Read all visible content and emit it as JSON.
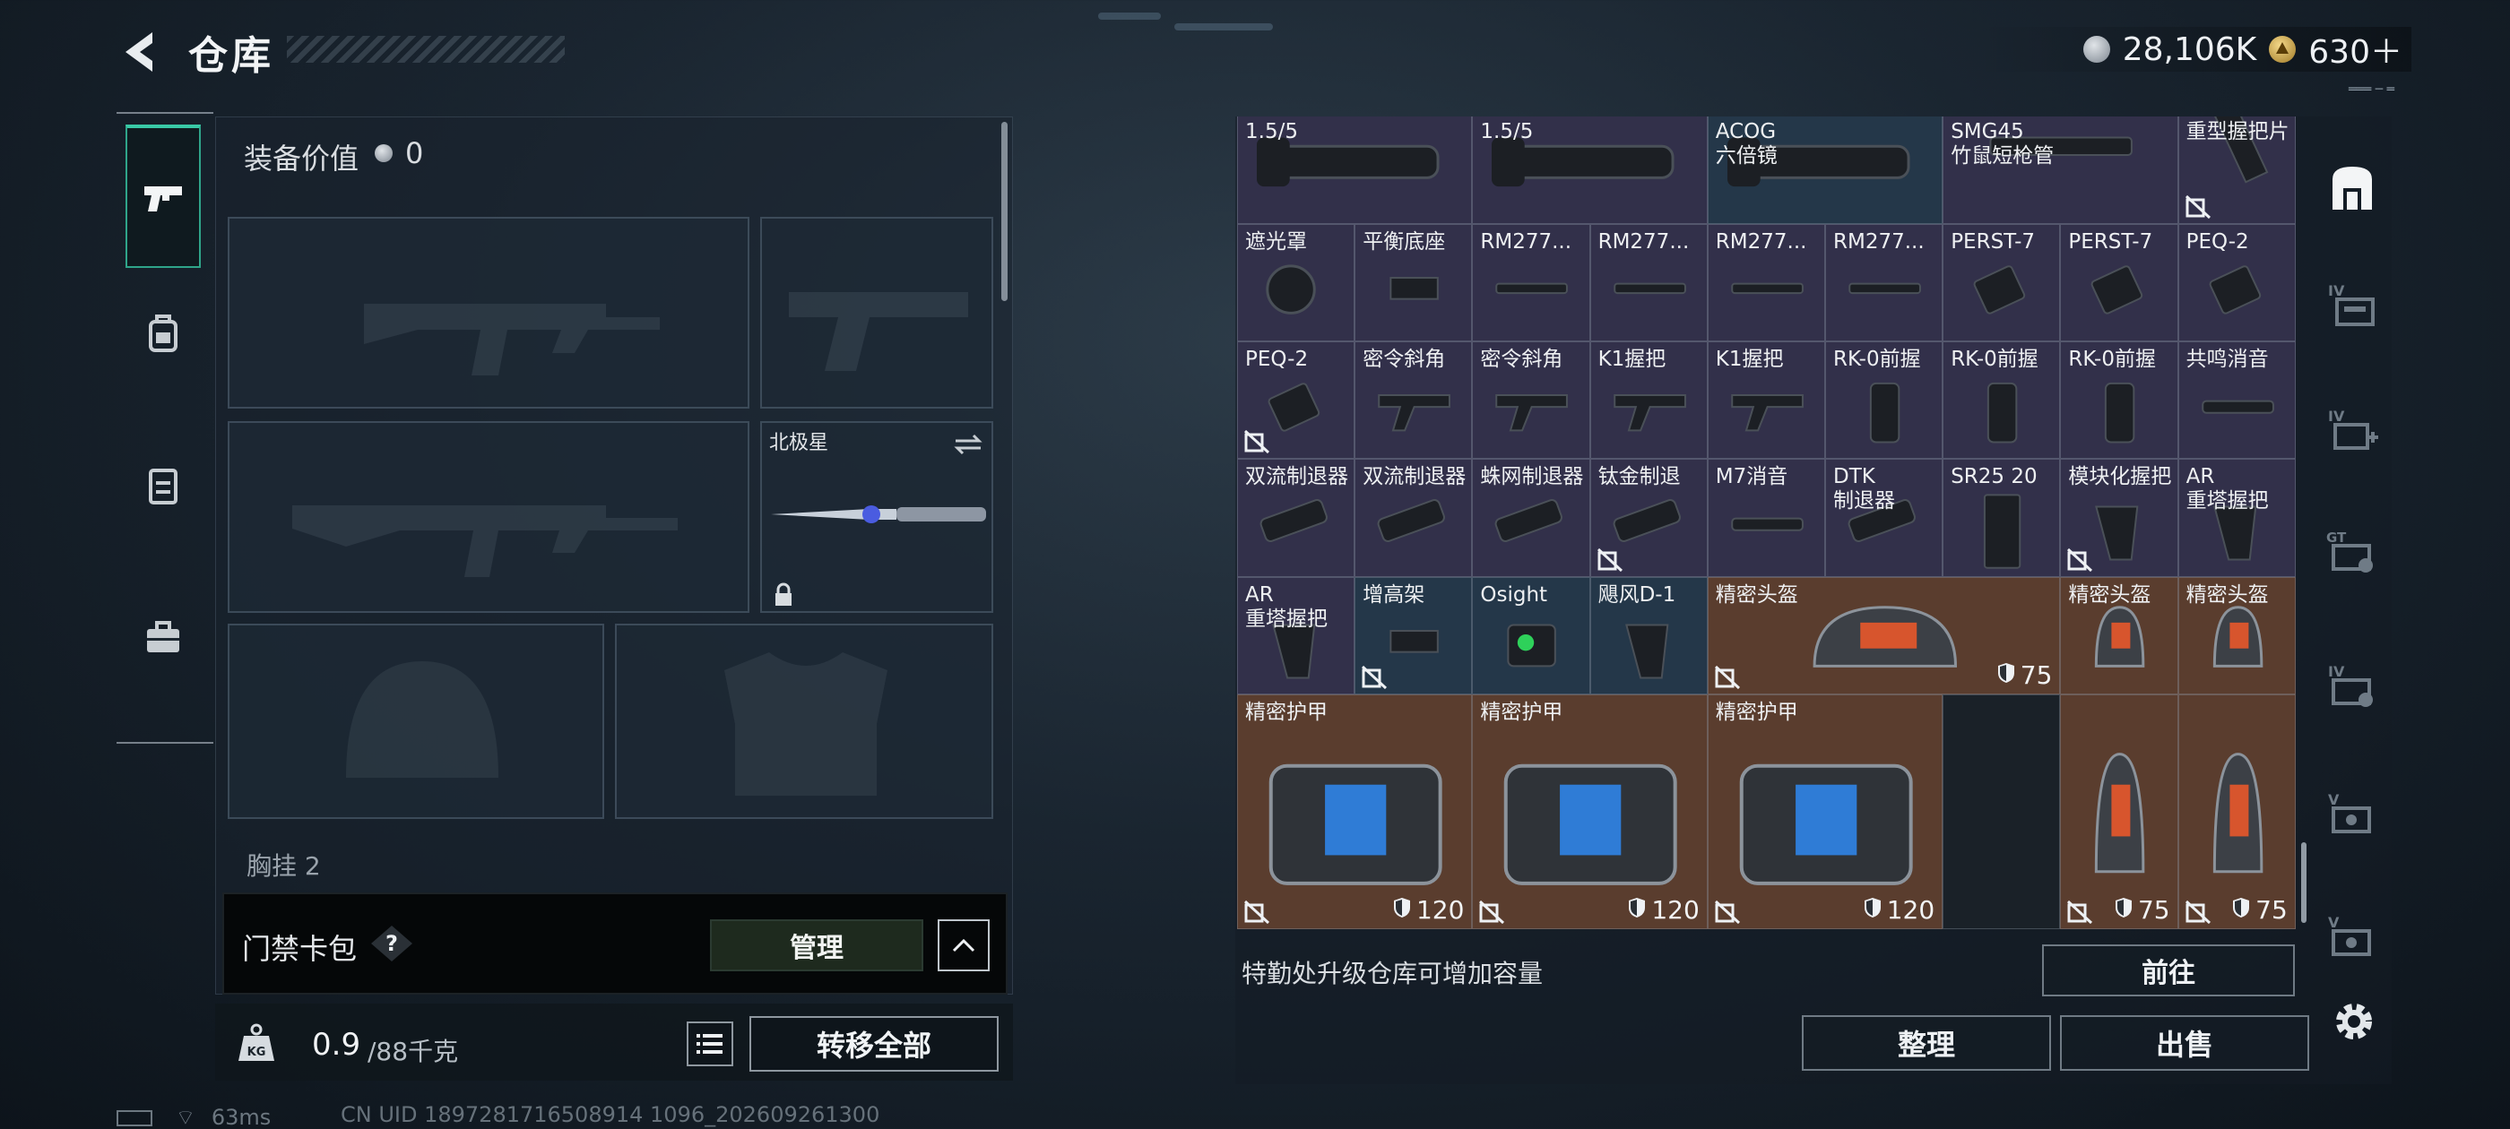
{
  "header": {
    "title": "仓库",
    "currency_silver": "28,106K",
    "currency_gold": "630＋",
    "version_text": "═══ ─ ═"
  },
  "left_panel": {
    "equip_value_label": "装备价值",
    "equip_value": "0",
    "melee_slot_label": "北极星",
    "cutoff_label": "胸挂 2",
    "card_bag_label": "门禁卡包",
    "manage_label": "管理",
    "weight_value": "0.9",
    "weight_max": "/88千克",
    "kg_label": "KG",
    "transfer_all_label": "转移全部"
  },
  "status_bar": {
    "ping": "63ms",
    "uid": "CN UID 1897281716508914 1096_202609261300"
  },
  "warehouse": {
    "rows": [
      [
        {
          "name": "1.5/5",
          "color": "purple"
        },
        {
          "name": "1.5/5",
          "color": "purple"
        },
        {
          "name": "ACOG\n六倍镜",
          "color": "blue"
        },
        {
          "name": "SMG45\n竹鼠短枪管",
          "color": "purple"
        },
        {
          "name": "重型握把片",
          "color": "purple",
          "lock": true
        }
      ],
      [
        {
          "name": "遮光罩",
          "color": "purple"
        },
        {
          "name": "平衡底座",
          "color": "purple"
        },
        {
          "name": "RM277...",
          "color": "purple"
        },
        {
          "name": "RM277...",
          "color": "purple"
        },
        {
          "name": "RM277...",
          "color": "purple"
        },
        {
          "name": "RM277...",
          "color": "purple"
        },
        {
          "name": "PERST-7",
          "color": "purple"
        },
        {
          "name": "PERST-7",
          "color": "purple"
        },
        {
          "name": "PEQ-2",
          "color": "purple"
        }
      ],
      [
        {
          "name": "PEQ-2",
          "color": "purple",
          "lock": true
        },
        {
          "name": "密令斜角",
          "color": "purple"
        },
        {
          "name": "密令斜角",
          "color": "purple"
        },
        {
          "name": "K1握把",
          "color": "purple"
        },
        {
          "name": "K1握把",
          "color": "purple"
        },
        {
          "name": "RK-0前握",
          "color": "purple"
        },
        {
          "name": "RK-0前握",
          "color": "purple"
        },
        {
          "name": "RK-0前握",
          "color": "purple"
        },
        {
          "name": "共鸣消音",
          "color": "purple"
        }
      ],
      [
        {
          "name": "双流制退器",
          "color": "purple"
        },
        {
          "name": "双流制退器",
          "color": "purple"
        },
        {
          "name": "蛛网制退器",
          "color": "purple"
        },
        {
          "name": "钛金制退",
          "color": "purple",
          "lock": true
        },
        {
          "name": "M7消音",
          "color": "purple"
        },
        {
          "name": "DTK\n制退器",
          "color": "purple"
        },
        {
          "name": "SR25 20",
          "color": "purple"
        },
        {
          "name": "模块化握把",
          "color": "purple",
          "lock": true
        },
        {
          "name": "AR\n重塔握把",
          "color": "purple"
        }
      ],
      [
        {
          "name": "AR\n重塔握把",
          "color": "purple"
        },
        {
          "name": "增高架",
          "color": "blue",
          "lock": true
        },
        {
          "name": "Osight",
          "color": "blue"
        },
        {
          "name": "飓风D-1",
          "color": "blue"
        },
        {
          "name": "精密头盔",
          "color": "brown",
          "lock": true,
          "durability": "75"
        },
        {
          "name": "精密头盔",
          "color": "brown"
        },
        {
          "name": "精密头盔",
          "color": "brown"
        }
      ],
      [
        {
          "name": "精密护甲",
          "color": "brown",
          "lock": true,
          "durability": "120"
        },
        {
          "name": "精密护甲",
          "color": "brown",
          "lock": true,
          "durability": "120"
        },
        {
          "name": "精密护甲",
          "color": "brown",
          "lock": true,
          "durability": "120"
        },
        {
          "name": "",
          "color": "dark"
        },
        {
          "name": "",
          "color": "brown",
          "lock": true,
          "durability": "75"
        },
        {
          "name": "",
          "color": "brown",
          "lock": true,
          "durability": "75"
        }
      ]
    ],
    "upgrade_tip": "特勤处升级仓库可增加容量",
    "goto_label": "前往",
    "sort_label": "整理",
    "sell_label": "出售"
  },
  "colors": {
    "purple": "#32304a",
    "blue": "#243749",
    "brown": "#5a3d2e",
    "dark": "#1a2128",
    "accent_green": "#39c9a6"
  },
  "icons": {
    "rail": [
      "pistol-icon",
      "backpack-icon",
      "chest-rig-icon",
      "toolbox-icon"
    ],
    "categories": [
      "all-items-icon",
      "weapon-category-iv-icon",
      "medical-category-iv-icon",
      "gear-category-gt-icon",
      "ammo-category-iv-icon",
      "key-category-v-icon",
      "misc-category-v-icon"
    ]
  }
}
